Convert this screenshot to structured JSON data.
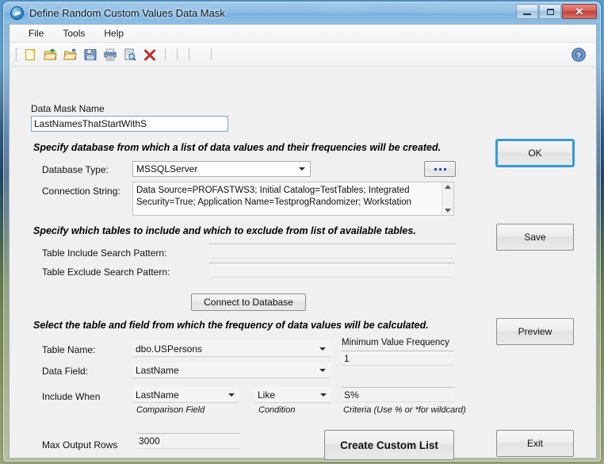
{
  "window": {
    "title": "Define Random Custom Values Data Mask",
    "app_icon": "app-circle-icon",
    "minimize_label": "Minimize",
    "maximize_label": "Maximize",
    "close_label": "Close",
    "close_glyph": "✕"
  },
  "menu": {
    "items": [
      {
        "label": "File"
      },
      {
        "label": "Tools"
      },
      {
        "label": "Help"
      }
    ]
  },
  "toolbar": {
    "buttons": [
      {
        "name": "new-document-icon",
        "tooltip": "New"
      },
      {
        "name": "open-folder-icon",
        "tooltip": "Open"
      },
      {
        "name": "open-folder-alt-icon",
        "tooltip": "Open Recent"
      },
      {
        "name": "save-floppy-icon",
        "tooltip": "Save"
      },
      {
        "name": "print-icon",
        "tooltip": "Print"
      },
      {
        "name": "print-preview-icon",
        "tooltip": "Print Preview"
      },
      {
        "name": "delete-red-x-icon",
        "tooltip": "Delete"
      }
    ],
    "help_icon": "help-question-icon"
  },
  "form": {
    "data_mask_name_label": "Data Mask Name",
    "data_mask_name_value": "LastNamesThatStartWithS",
    "section1_heading": "Specify database from which a list of data values and their frequencies will be created.",
    "database_type_label": "Database Type:",
    "database_type_value": "MSSQLServer",
    "browse_button_label": "...",
    "connection_string_label": "Connection String:",
    "connection_string_value": "Data Source=PROFASTWS3; Initial Catalog=TestTables; Integrated Security=True; Application Name=TestprogRandomizer; Workstation",
    "section2_heading": "Specify which tables to include and which to exclude from list of available tables.",
    "table_include_label": "Table Include Search Pattern:",
    "table_include_value": "",
    "table_exclude_label": "Table Exclude Search Pattern:",
    "table_exclude_value": "",
    "connect_button_label": "Connect to Database",
    "section3_heading": "Select the table and field from which the frequency of data values will be calculated.",
    "table_name_label": "Table Name:",
    "table_name_value": "dbo.USPersons",
    "data_field_label": "Data Field:",
    "data_field_value": "LastName",
    "min_value_frequency_label": "Minimum Value Frequency",
    "min_value_frequency_value": "1",
    "include_when_label": "Include When",
    "comparison_field_value": "LastName",
    "comparison_field_caption": "Comparison Field",
    "condition_value": "Like",
    "condition_caption": "Condition",
    "criteria_value": "S%",
    "criteria_caption": "Criteria (Use % or *for wildcard)",
    "max_output_rows_label": "Max Output Rows",
    "max_output_rows_value": "3000",
    "create_custom_list_label": "Create Custom  List"
  },
  "side_buttons": [
    {
      "name": "ok-button",
      "label": "OK",
      "focused": true
    },
    {
      "name": "save-button",
      "label": "Save",
      "focused": false
    },
    {
      "name": "preview-button",
      "label": "Preview",
      "focused": false
    },
    {
      "name": "exit-button",
      "label": "Exit",
      "focused": false
    }
  ],
  "colors": {
    "accent_focus": "#2e9ae0",
    "close_red": "#bf3f39",
    "form_bg": "#f0f0f0",
    "field_bg": "#fdfdfd"
  }
}
